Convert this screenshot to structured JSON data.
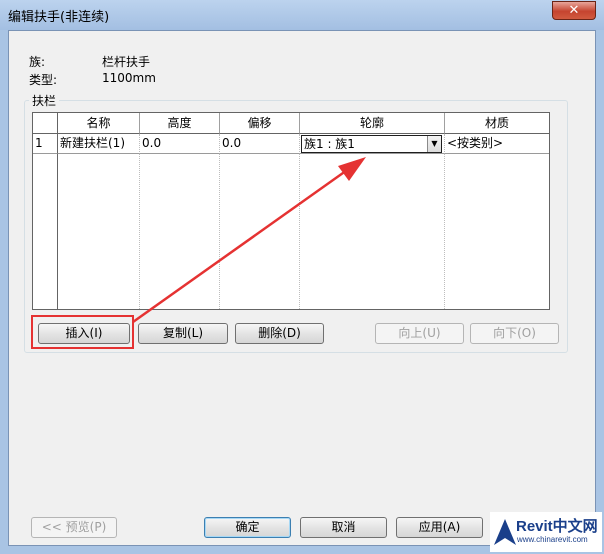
{
  "window": {
    "title": "编辑扶手(非连续)",
    "close_glyph": "✕"
  },
  "props": {
    "family_label": "族:",
    "family_value": "栏杆扶手",
    "type_label": "类型:",
    "type_value": "1100mm"
  },
  "group": {
    "title": "扶栏"
  },
  "table": {
    "columns": [
      "名称",
      "高度",
      "偏移",
      "轮廓",
      "材质"
    ],
    "rows": [
      {
        "index": "1",
        "name": "新建扶栏(1)",
        "height": "0.0",
        "offset": "0.0",
        "profile": "族1 : 族1",
        "material": "<按类别>"
      }
    ]
  },
  "buttons": {
    "insert": "插入(I)",
    "copy": "复制(L)",
    "delete": "删除(D)",
    "up": "向上(U)",
    "down": "向下(O)",
    "preview": "<< 预览(P)",
    "ok": "确定",
    "cancel": "取消",
    "apply": "应用(A)"
  },
  "watermark": {
    "main": "Revit中文网",
    "sub": "www.chinarevit.com"
  },
  "colors": {
    "annotation": "#e53232",
    "logo": "#1a3f8a"
  }
}
